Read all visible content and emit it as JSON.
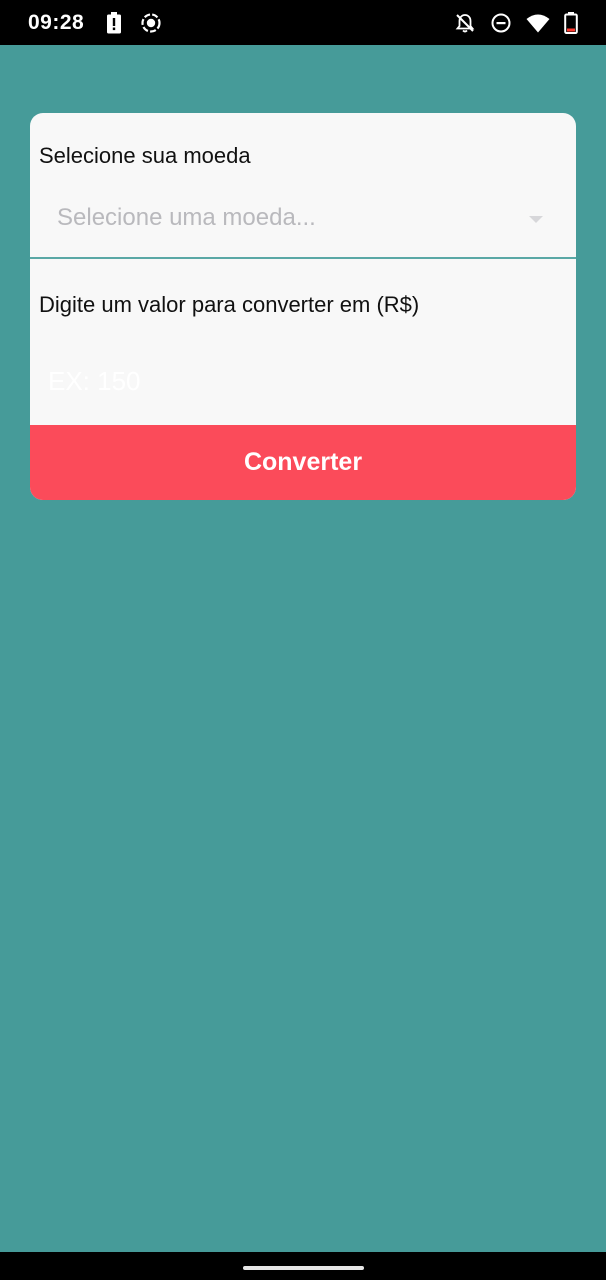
{
  "status_bar": {
    "time": "09:28",
    "left_icons": [
      "battery-alert-icon",
      "screen-record-icon"
    ],
    "right_icons": [
      "notifications-off-icon",
      "do-not-disturb-icon",
      "wifi-icon",
      "battery-icon"
    ]
  },
  "form": {
    "currency_label": "Selecione sua moeda",
    "currency_placeholder": "Selecione uma moeda...",
    "value_label": "Digite um valor para converter em (R$)",
    "value_placeholder": "EX: 150",
    "convert_label": "Converter"
  },
  "colors": {
    "background": "#469b99",
    "card": "#f8f8f8",
    "button": "#fb4b5a",
    "select_underline": "#5aa8a6"
  }
}
